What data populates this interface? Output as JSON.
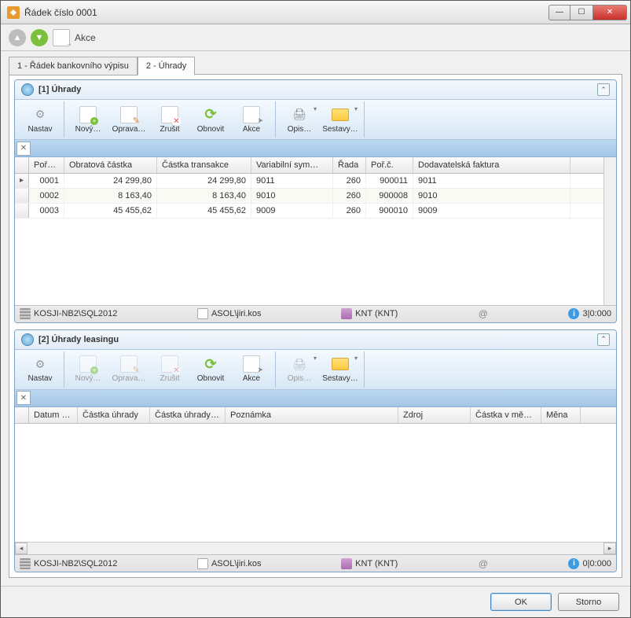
{
  "window": {
    "title": "Řádek číslo 0001"
  },
  "ribbon": {
    "action_label": "Akce"
  },
  "tabs": [
    {
      "label": "1 - Řádek bankovního výpisu"
    },
    {
      "label": "2 - Úhrady"
    }
  ],
  "section1": {
    "title": "[1] Úhrady",
    "toolbar": {
      "nastav": "Nastav",
      "novy": "Nový…",
      "oprava": "Oprava…",
      "zrusit": "Zrušit",
      "obnovit": "Obnovit",
      "akce": "Akce",
      "opis": "Opis…",
      "sestavy": "Sestavy…"
    },
    "columns": {
      "por": "Poř…",
      "obr": "Obratová částka",
      "trans": "Částka transakce",
      "varsym": "Variabilní sym…",
      "rada": "Řada",
      "porc": "Poř.č.",
      "dodav": "Dodavatelská faktura"
    },
    "rows": [
      {
        "por": "0001",
        "obr": "24 299,80",
        "trans": "24 299,80",
        "vs": "9011",
        "rada": "260",
        "porc": "900011",
        "dodav": "9011"
      },
      {
        "por": "0002",
        "obr": "8 163,40",
        "trans": "8 163,40",
        "vs": "9010",
        "rada": "260",
        "porc": "900008",
        "dodav": "9010"
      },
      {
        "por": "0003",
        "obr": "45 455,62",
        "trans": "45 455,62",
        "vs": "9009",
        "rada": "260",
        "porc": "900010",
        "dodav": "9009"
      }
    ],
    "status": {
      "server": "KOSJI-NB2\\SQL2012",
      "user": "ASOL\\jiri.kos",
      "db": "KNT (KNT)",
      "count": "3|0:000"
    }
  },
  "section2": {
    "title": "[2] Úhrady leasingu",
    "toolbar": {
      "nastav": "Nastav",
      "novy": "Nový…",
      "oprava": "Oprava…",
      "zrusit": "Zrušit",
      "obnovit": "Obnovit",
      "akce": "Akce",
      "opis": "Opis…",
      "sestavy": "Sestavy…"
    },
    "columns": {
      "datum": "Datum v…",
      "castka": "Částka úhrady",
      "castka2": "Částka úhrady …",
      "pozn": "Poznámka",
      "zdroj": "Zdroj",
      "mena_castka": "Částka v měně…",
      "mena": "Měna"
    },
    "status": {
      "server": "KOSJI-NB2\\SQL2012",
      "user": "ASOL\\jiri.kos",
      "db": "KNT (KNT)",
      "count": "0|0:000"
    }
  },
  "buttons": {
    "ok": "OK",
    "storno": "Storno"
  }
}
